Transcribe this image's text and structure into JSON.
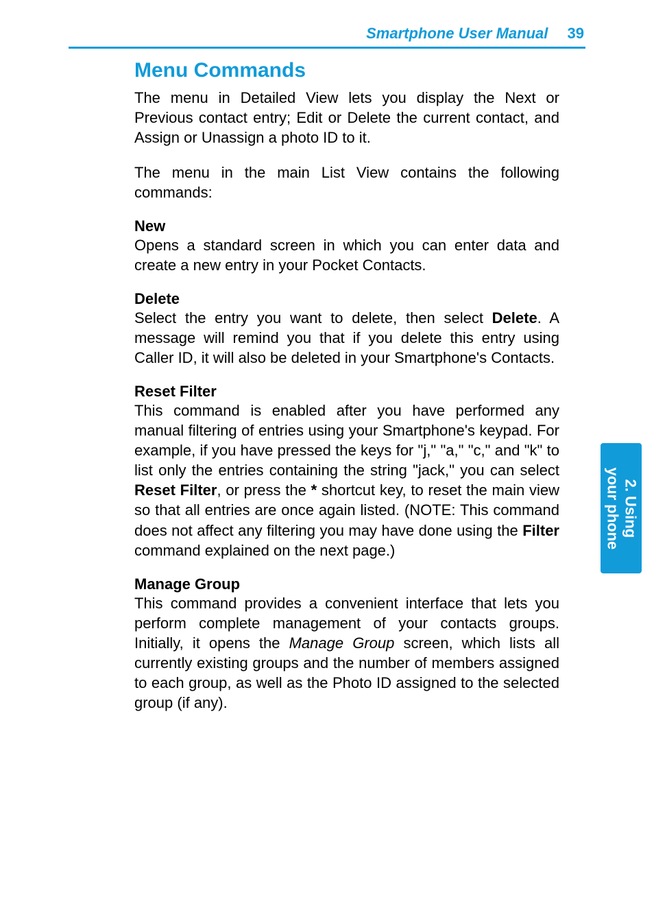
{
  "header": {
    "title": "Smartphone User Manual",
    "page_number": "39"
  },
  "section": {
    "title": "Menu Commands",
    "intro1": "The menu in Detailed View lets you display the Next or Previous contact entry; Edit or Delete the current contact, and Assign or Unassign a photo ID to it.",
    "intro2": "The menu in the main List View contains the following commands:"
  },
  "commands": {
    "new": {
      "heading": "New",
      "body": "Opens a standard screen in which you can enter data and create a new entry in your Pocket Contacts."
    },
    "delete": {
      "heading": "Delete",
      "body_pre": "Select the entry you want to delete, then select ",
      "body_bold1": "Delete",
      "body_post": ".  A message will remind you that if you delete this entry using Caller ID, it will also be deleted in your Smartphone's Contacts."
    },
    "reset_filter": {
      "heading": "Reset Filter",
      "body_pre": "This command is enabled after you have performed any manual filtering of entries using your Smartphone's keypad.  For example, if you have pressed the keys for \"j,\" \"a,\" \"c,\" and \"k\" to list only the entries containing the string \"jack,\" you can select ",
      "body_bold1": "Reset Filter",
      "body_mid1": ", or press the ",
      "body_bold2": "*",
      "body_mid2": " shortcut key, to reset the main view so that all entries are once again listed.  (NOTE:  This command does not affect any filtering you may have done using the ",
      "body_bold3": "Filter",
      "body_post": " command explained on the next page.)"
    },
    "manage_group": {
      "heading": "Manage Group",
      "body_pre": "This command provides a convenient interface that lets you perform complete management of your contacts groups.  Initially, it opens the ",
      "body_italic": "Manage Group",
      "body_post": " screen, which lists all currently existing groups and the number of members assigned to each group, as well as the Photo ID assigned to the selected group (if any)."
    }
  },
  "side_tab": {
    "line1": "2. Using",
    "line2": "your phone"
  }
}
